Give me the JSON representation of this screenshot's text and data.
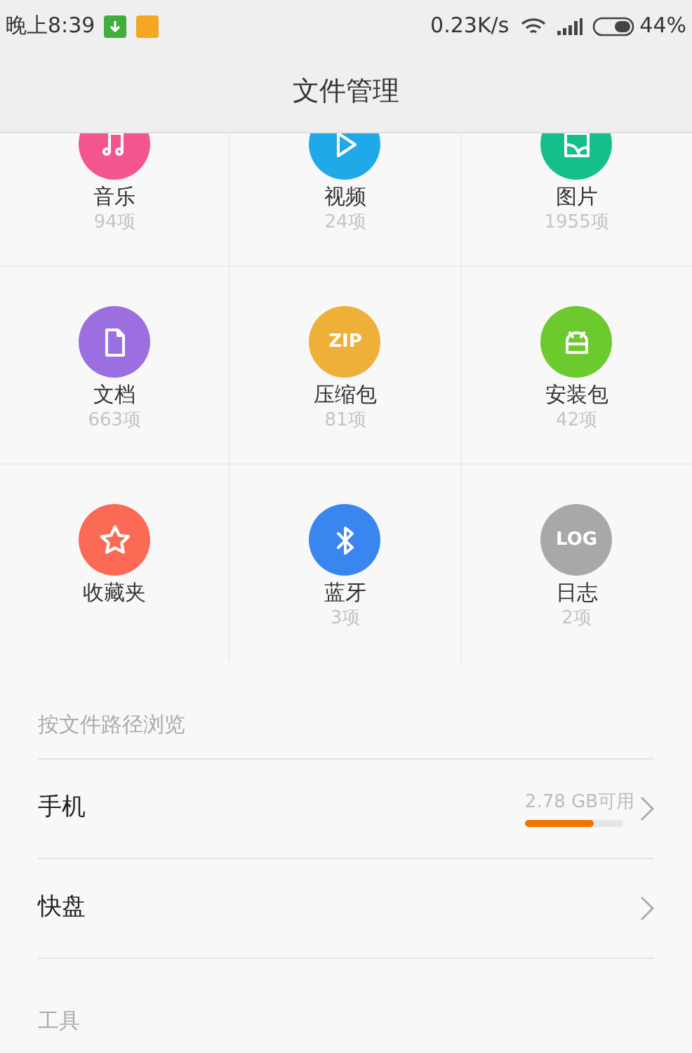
{
  "status_bar": {
    "time": "晚上8:39",
    "speed": "0.23K/s",
    "battery": "44%"
  },
  "title": "文件管理",
  "categories": [
    {
      "label": "音乐",
      "count": "94项",
      "kind": "music",
      "color": "#f5558f"
    },
    {
      "label": "视频",
      "count": "24项",
      "kind": "video",
      "color": "#1fa9e8"
    },
    {
      "label": "图片",
      "count": "1955项",
      "kind": "image",
      "color": "#14bf8c"
    },
    {
      "label": "文档",
      "count": "663项",
      "kind": "document",
      "color": "#9b6fe0"
    },
    {
      "label": "压缩包",
      "count": "81项",
      "kind": "text",
      "badge": "ZIP",
      "color": "#efb03a"
    },
    {
      "label": "安装包",
      "count": "42项",
      "kind": "apk",
      "color": "#6cc92e"
    },
    {
      "label": "收藏夹",
      "kind": "star",
      "color": "#fa6a55"
    },
    {
      "label": "蓝牙",
      "count": "3项",
      "kind": "bluetooth",
      "color": "#3a86f0"
    },
    {
      "label": "日志",
      "count": "2项",
      "kind": "text",
      "badge": "LOG",
      "color": "#a8a8a8"
    }
  ],
  "browse": {
    "heading": "按文件路径浏览",
    "items": [
      {
        "label": "手机",
        "free": "2.78 GB可用",
        "level": 0.7
      },
      {
        "label": "快盘"
      }
    ]
  },
  "tools": {
    "heading": "工具"
  }
}
